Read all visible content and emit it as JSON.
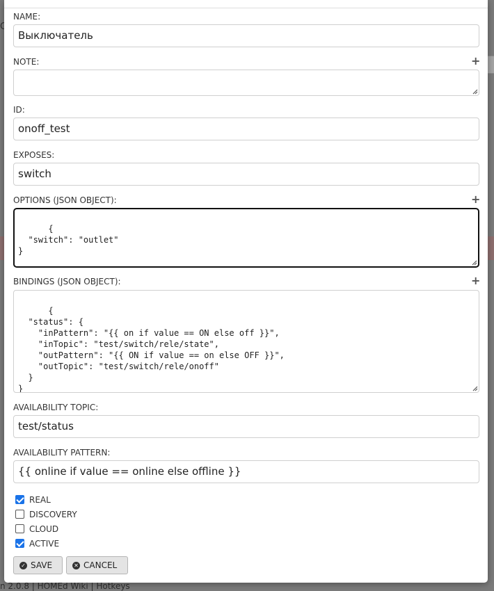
{
  "background": {
    "fragment_left": "C",
    "footer_text": "n 2.0.8 | HOMEd Wiki | Hotkeys"
  },
  "form": {
    "name": {
      "label": "NAME:",
      "value": "Выключатель"
    },
    "note": {
      "label": "NOTE:",
      "value": ""
    },
    "id": {
      "label": "ID:",
      "value": "onoff_test"
    },
    "exposes": {
      "label": "EXPOSES:",
      "value": "switch"
    },
    "options": {
      "label": "OPTIONS (JSON OBJECT):",
      "value": "{\n  \"switch\": \"outlet\"\n}"
    },
    "bindings": {
      "label": "BINDINGS (JSON OBJECT):",
      "value": "{\n  \"status\": {\n    \"inPattern\": \"{{ on if value == ON else off }}\",\n    \"inTopic\": \"test/switch/rele/state\",\n    \"outPattern\": \"{{ ON if value == on else OFF }}\",\n    \"outTopic\": \"test/switch/rele/onoff\"\n  }\n}"
    },
    "availability_topic": {
      "label": "AVAILABILITY TOPIC:",
      "value": "test/status"
    },
    "availability_pattern": {
      "label": "AVAILABILITY PATTERN:",
      "value": "{{ online if value == online else offline }}"
    },
    "add_icon": "plus-icon",
    "checkboxes": [
      {
        "label": "REAL",
        "checked": true
      },
      {
        "label": "DISCOVERY",
        "checked": false
      },
      {
        "label": "CLOUD",
        "checked": false
      },
      {
        "label": "ACTIVE",
        "checked": true
      }
    ]
  },
  "buttons": {
    "save_label": "SAVE",
    "save_icon": "check-circle-icon",
    "cancel_label": "CANCEL",
    "cancel_icon": "times-circle-icon"
  },
  "colors": {
    "checkbox_checked": "#1a73e8",
    "button_bg": "#e4e4e4",
    "overlay": "#7b7b7b"
  }
}
